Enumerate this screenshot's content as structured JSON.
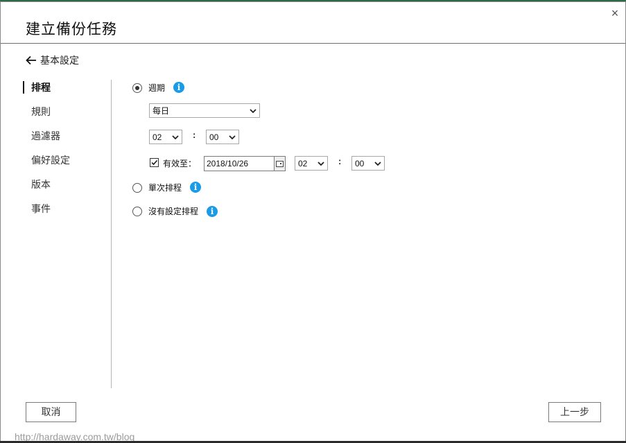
{
  "dialog": {
    "title": "建立備份任務",
    "close_glyph": "×",
    "back_label": "基本設定"
  },
  "nav": {
    "items": [
      {
        "label": "排程",
        "active": true
      },
      {
        "label": "規則",
        "active": false
      },
      {
        "label": "過濾器",
        "active": false
      },
      {
        "label": "偏好設定",
        "active": false
      },
      {
        "label": "版本",
        "active": false
      },
      {
        "label": "事件",
        "active": false
      }
    ]
  },
  "schedule": {
    "periodic_label": "週期",
    "frequency_value": "每日",
    "hour_value": "02",
    "minute_value": "00",
    "time_separator": ":",
    "valid_until_label": "有效至：",
    "valid_until_checked": true,
    "valid_until_date": "2018/10/26",
    "until_hour_value": "02",
    "until_minute_value": "00",
    "once_label": "單次排程",
    "none_label": "沒有設定排程",
    "selected": "periodic",
    "info_glyph": "i"
  },
  "footer": {
    "cancel_label": "取消",
    "prev_label": "上一步"
  },
  "watermark": "http://hardaway.com.tw/blog",
  "colors": {
    "accent_info": "#1a9be8",
    "border": "#a8a8a8"
  }
}
